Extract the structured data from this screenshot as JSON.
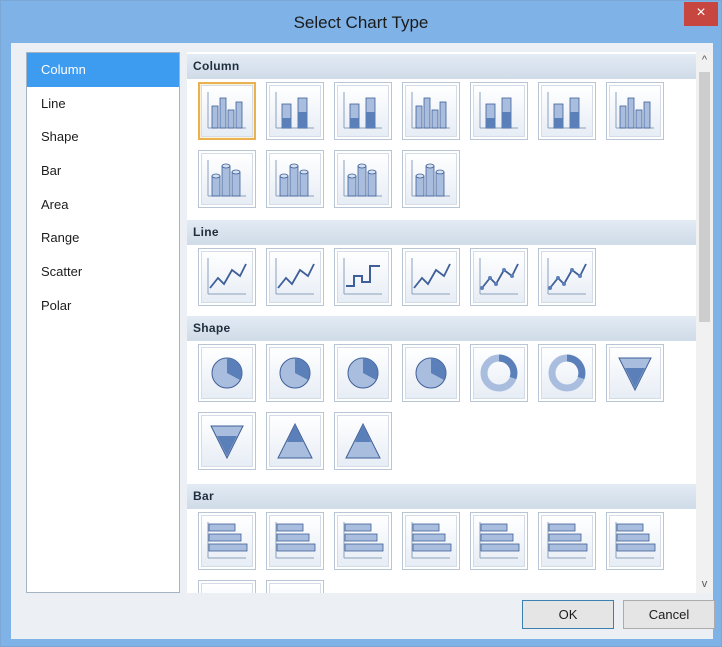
{
  "window": {
    "title": "Select Chart Type",
    "close_glyph": "×"
  },
  "categories": [
    "Column",
    "Line",
    "Shape",
    "Bar",
    "Area",
    "Range",
    "Scatter",
    "Polar"
  ],
  "selected_category": "Column",
  "sections": {
    "column": {
      "label": "Column",
      "icons": [
        "column-clustered",
        "column-stacked",
        "column-100-stacked",
        "column-3d-clustered",
        "column-3d-stacked",
        "column-3d-100-stacked",
        "column-3d",
        "cylinder-clustered",
        "cylinder-stacked",
        "cylinder-100-stacked",
        "cylinder-3d"
      ]
    },
    "line": {
      "label": "Line",
      "icons": [
        "line",
        "spline",
        "step-line",
        "line-3d",
        "line-markers",
        "spline-markers"
      ]
    },
    "shape": {
      "label": "Shape",
      "icons": [
        "pie",
        "exploded-pie",
        "pie-3d",
        "exploded-pie-3d",
        "doughnut",
        "exploded-doughnut",
        "funnel",
        "funnel-3d",
        "pyramid",
        "pyramid-3d"
      ]
    },
    "bar": {
      "label": "Bar",
      "icons": [
        "bar-clustered",
        "bar-stacked",
        "bar-100-stacked",
        "bar-3d-clustered",
        "bar-3d-stacked",
        "bar-3d-100-stacked",
        "bar-cylinder"
      ]
    }
  },
  "buttons": {
    "ok": "OK",
    "cancel": "Cancel"
  },
  "scroll": {
    "up_glyph": "^",
    "down_glyph": "v"
  }
}
